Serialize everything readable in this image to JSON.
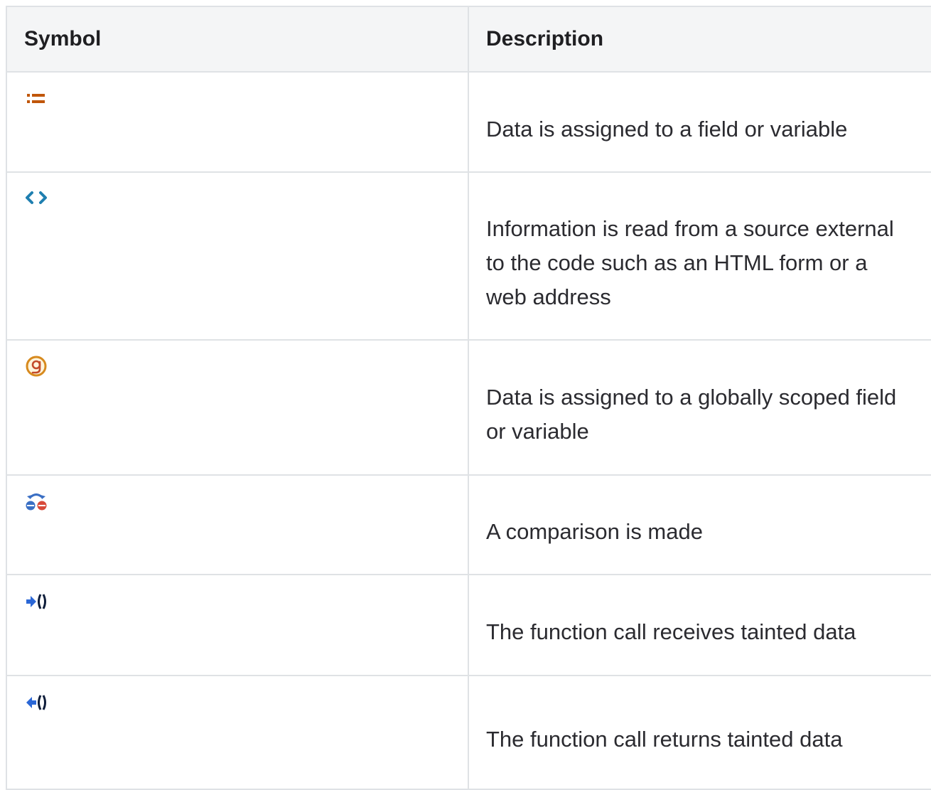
{
  "table": {
    "headers": {
      "symbol": "Symbol",
      "description": "Description"
    },
    "rows": [
      {
        "icon": "assignment-icon",
        "description": "Data is assigned to a field or variable"
      },
      {
        "icon": "external-source-icon",
        "description": "Information is read from a source external to the code such as an HTML form or a web address"
      },
      {
        "icon": "global-scope-icon",
        "description": "Data is assigned to a globally scoped field or variable"
      },
      {
        "icon": "comparison-icon",
        "description": "A comparison is made"
      },
      {
        "icon": "function-call-receives-icon",
        "description": "The function call receives tainted data"
      },
      {
        "icon": "function-call-returns-icon",
        "description": "The function call returns tainted data"
      }
    ]
  },
  "colors": {
    "header_background": "#f4f5f6",
    "border": "#dfe2e5",
    "assignment_icon": "#c0560a",
    "external_source_icon": "#1f7fb0",
    "global_scope_icon": "#d78a1e",
    "comparison_icon_blue": "#3a6fc4",
    "comparison_icon_red": "#d84a3a",
    "function_call_icon": "#1c4fb8"
  }
}
